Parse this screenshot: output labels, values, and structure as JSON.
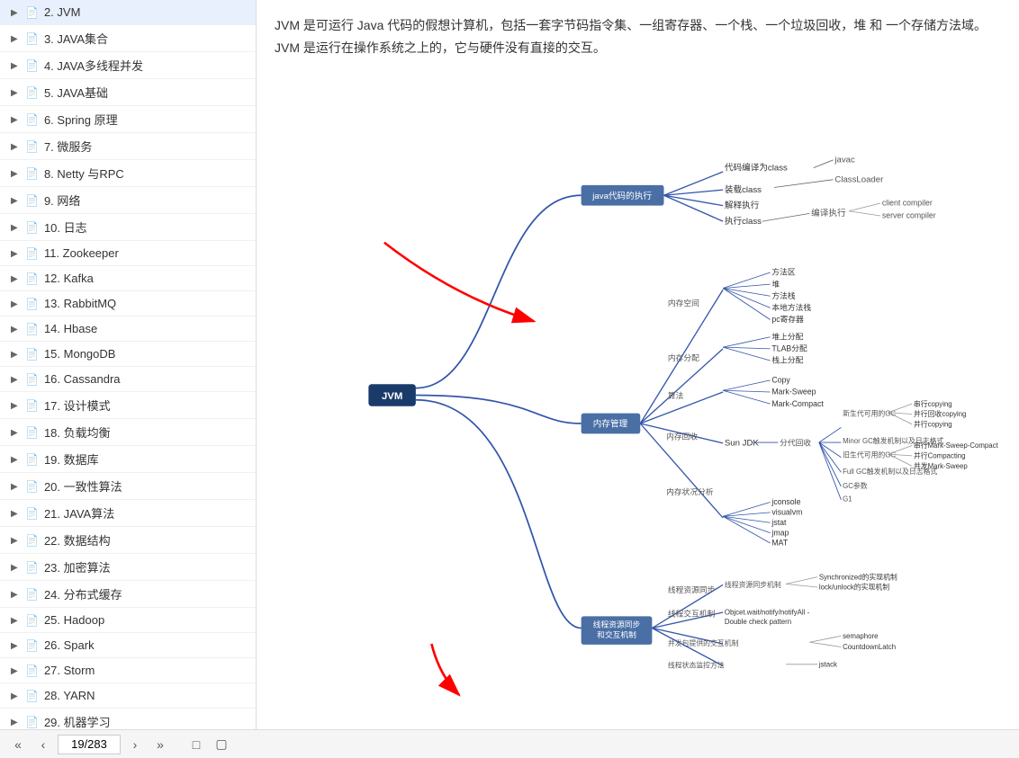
{
  "sidebar": {
    "items": [
      {
        "id": 2,
        "label": "2. JVM",
        "active": false
      },
      {
        "id": 3,
        "label": "3. JAVA集合",
        "active": false
      },
      {
        "id": 4,
        "label": "4. JAVA多线程并发",
        "active": false
      },
      {
        "id": 5,
        "label": "5. JAVA基础",
        "active": false
      },
      {
        "id": 6,
        "label": "6. Spring 原理",
        "active": false
      },
      {
        "id": 7,
        "label": "7. 微服务",
        "active": false
      },
      {
        "id": 8,
        "label": "8. Netty 与RPC",
        "active": false
      },
      {
        "id": 9,
        "label": "9. 网络",
        "active": false
      },
      {
        "id": 10,
        "label": "10. 日志",
        "active": false
      },
      {
        "id": 11,
        "label": "11. Zookeeper",
        "active": false
      },
      {
        "id": 12,
        "label": "12. Kafka",
        "active": false
      },
      {
        "id": 13,
        "label": "13. RabbitMQ",
        "active": false
      },
      {
        "id": 14,
        "label": "14. Hbase",
        "active": false
      },
      {
        "id": 15,
        "label": "15. MongoDB",
        "active": false
      },
      {
        "id": 16,
        "label": "16. Cassandra",
        "active": false
      },
      {
        "id": 17,
        "label": "17. 设计模式",
        "active": false
      },
      {
        "id": 18,
        "label": "18. 负载均衡",
        "active": false
      },
      {
        "id": 19,
        "label": "19. 数据库",
        "active": false
      },
      {
        "id": 20,
        "label": "20. 一致性算法",
        "active": false
      },
      {
        "id": 21,
        "label": "21. JAVA算法",
        "active": false
      },
      {
        "id": 22,
        "label": "22. 数据结构",
        "active": false
      },
      {
        "id": 23,
        "label": "23. 加密算法",
        "active": false
      },
      {
        "id": 24,
        "label": "24. 分布式缓存",
        "active": false
      },
      {
        "id": 25,
        "label": "25. Hadoop",
        "active": false
      },
      {
        "id": 26,
        "label": "26. Spark",
        "active": false
      },
      {
        "id": 27,
        "label": "27. Storm",
        "active": false
      },
      {
        "id": 28,
        "label": "28. YARN",
        "active": false
      },
      {
        "id": 29,
        "label": "29. 机器学习",
        "active": false
      }
    ]
  },
  "description": "JVM 是可运行 Java 代码的假想计算机，包括一套字节码指令集、一组寄存器、一个栈、一个垃圾回收，堆 和 一个存储方法域。JVM 是运行在操作系统之上的，它与硬件没有直接的交互。",
  "toolbar": {
    "page_current": "19",
    "page_total": "283",
    "nav_first": "«",
    "nav_prev": "‹",
    "nav_next": "›",
    "nav_last": "»",
    "page_separator": "/"
  },
  "mindmap": {
    "center": "JVM",
    "branches": {
      "java_exec": {
        "label": "java代码的执行",
        "children": [
          {
            "label": "代码编译为class",
            "sub": "javac"
          },
          {
            "label": "装载class",
            "sub": "ClassLoader"
          },
          {
            "label": "解释执行",
            "sub": ""
          },
          {
            "label": "执行class",
            "sub": ""
          },
          {
            "label": "编译执行",
            "sub": "client compiler"
          },
          {
            "label": "",
            "sub": "server compiler"
          }
        ]
      },
      "mem_mgmt": {
        "label": "内存管理",
        "children": {
          "mem_space": {
            "label": "内存空间",
            "items": [
              "方法区",
              "堆",
              "方法栈",
              "本地方法栈",
              "pc寄存器"
            ]
          },
          "mem_alloc": {
            "label": "内存分配",
            "items": [
              "堆上分配",
              "TLAB分配",
              "栈上分配"
            ]
          },
          "algorithm": {
            "label": "算法",
            "items": [
              "Copy",
              "Mark-Sweep",
              "Mark-Compact"
            ]
          },
          "mem_reclaim": {
            "label": "内存回收",
            "sub": {
              "sun_jdk": {
                "label": "Sun JDK",
                "sub": {
                  "generational": {
                    "label": "分代回收",
                    "new_gen": {
                      "label": "新生代可用的GC",
                      "items": [
                        "串行copying",
                        "并行回收copying",
                        "并行copying"
                      ]
                    },
                    "minor": "Minor GC触发机制以及日志格式",
                    "old_gen": {
                      "label": "旧生代可用的GC",
                      "items": [
                        "串行Mark-Sweep-Compact",
                        "并行Compacting",
                        "并发Mark-Sweep"
                      ]
                    },
                    "full_gc": "Full GC触发机制以及日志格式",
                    "gc_params": "GC参数",
                    "g1": "G1"
                  }
                }
              }
            }
          },
          "mem_status": {
            "label": "内存状况分析",
            "items": [
              "jconsole",
              "visualvm",
              "jstat",
              "jmap",
              "MAT"
            ]
          }
        }
      },
      "thread": {
        "label": "线程资源同步\n和交互机制",
        "children": {
          "thread_sync": {
            "label": "线程资源同步",
            "sub": {
              "sync_mechanism": {
                "label": "线程资源同步机制",
                "items": [
                  "Synchronized的实现机制",
                  "lock/unlock的实现机制"
                ]
              }
            }
          },
          "thread_interact": {
            "label": "线程交互机制",
            "items": [
              "Objcet.wait/notify/notifyAll - Double check pattern"
            ]
          },
          "provided_interact": {
            "label": "并发包提供的交互机制",
            "items": [
              "semaphore",
              "CountdownLatch"
            ]
          },
          "thread_tools": {
            "label": "线程状态监控方法",
            "items": [
              "jstack"
            ]
          }
        }
      }
    }
  }
}
